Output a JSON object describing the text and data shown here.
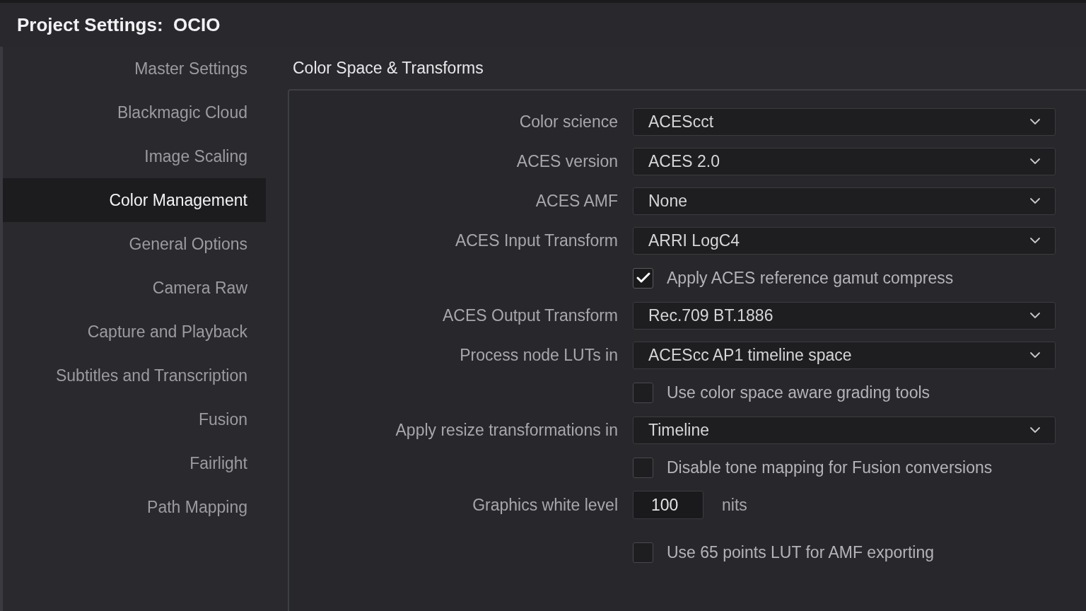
{
  "window": {
    "title": "Project Settings:  OCIO"
  },
  "sidebar": {
    "items": [
      {
        "label": "Master Settings",
        "selected": false
      },
      {
        "label": "Blackmagic Cloud",
        "selected": false
      },
      {
        "label": "Image Scaling",
        "selected": false
      },
      {
        "label": "Color Management",
        "selected": true
      },
      {
        "label": "General Options",
        "selected": false
      },
      {
        "label": "Camera Raw",
        "selected": false
      },
      {
        "label": "Capture and Playback",
        "selected": false
      },
      {
        "label": "Subtitles and Transcription",
        "selected": false
      },
      {
        "label": "Fusion",
        "selected": false
      },
      {
        "label": "Fairlight",
        "selected": false
      },
      {
        "label": "Path Mapping",
        "selected": false
      }
    ]
  },
  "section": {
    "title": "Color Space & Transforms",
    "settings": [
      {
        "kind": "dropdown",
        "label": "Color science",
        "value": "ACEScct"
      },
      {
        "kind": "dropdown",
        "label": "ACES version",
        "value": "ACES 2.0"
      },
      {
        "kind": "dropdown",
        "label": "ACES AMF",
        "value": "None"
      },
      {
        "kind": "dropdown",
        "label": "ACES Input Transform",
        "value": "ARRI LogC4"
      },
      {
        "kind": "checkbox",
        "label": "Apply ACES reference gamut compress",
        "checked": true
      },
      {
        "kind": "dropdown",
        "label": "ACES Output Transform",
        "value": "Rec.709 BT.1886"
      },
      {
        "kind": "dropdown",
        "label": "Process node LUTs in",
        "value": "ACEScc AP1 timeline space"
      },
      {
        "kind": "checkbox",
        "label": "Use color space aware grading tools",
        "checked": false
      },
      {
        "kind": "dropdown",
        "label": "Apply resize transformations in",
        "value": "Timeline"
      },
      {
        "kind": "checkbox",
        "label": "Disable tone mapping for Fusion conversions",
        "checked": false
      },
      {
        "kind": "number",
        "label": "Graphics white level",
        "value": "100",
        "unit": "nits"
      },
      {
        "kind": "checkbox",
        "label": "Use 65 points LUT for AMF exporting",
        "checked": false
      }
    ]
  }
}
